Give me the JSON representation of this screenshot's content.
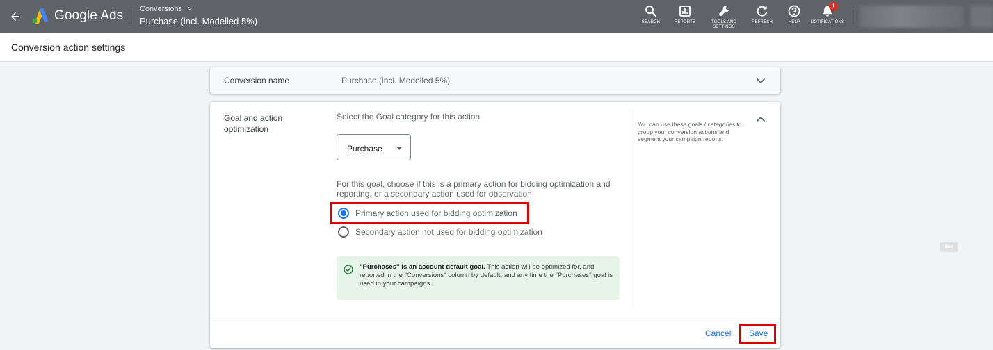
{
  "topbar": {
    "app_name": "Google Ads",
    "breadcrumb": "Conversions",
    "breadcrumb_arrow": ">",
    "page_name": "Purchase (incl. Modelled 5%)",
    "tools": [
      {
        "label": "SEARCH",
        "icon": "search-icon"
      },
      {
        "label": "REPORTS",
        "icon": "reports-icon"
      },
      {
        "label": "TOOLS AND SETTINGS",
        "icon": "wrench-icon"
      },
      {
        "label": "REFRESH",
        "icon": "refresh-icon"
      },
      {
        "label": "HELP",
        "icon": "help-icon"
      },
      {
        "label": "NOTIFICATIONS",
        "icon": "bell-icon",
        "badge": "!"
      }
    ]
  },
  "subheader": {
    "title": "Conversion action settings"
  },
  "conversion_name": {
    "label": "Conversion name",
    "value": "Purchase (incl. Modelled 5%)"
  },
  "goal": {
    "label": "Goal and action optimization",
    "select_heading": "Select the Goal category for this action",
    "category_value": "Purchase",
    "description": "For this goal, choose if this is a primary action for bidding optimization and reporting, or a secondary action used for observation.",
    "options": [
      {
        "label": "Primary action used for bidding optimization",
        "selected": true
      },
      {
        "label": "Secondary action not used for bidding optimization",
        "selected": false
      }
    ],
    "info_bold": "\"Purchases\" is an account default goal.",
    "info_text": " This action will be optimized for, and reported in the \"Conversions\" column by default, and any time the \"Purchases\" goal is used in your campaigns.",
    "help_text": "You can use these goals / categories to group your conversion actions and segment your campaign reports."
  },
  "actions": {
    "cancel": "Cancel",
    "save": "Save"
  },
  "blur_tag": "Blur",
  "colors": {
    "topbar": "#5f6368",
    "accent": "#1a73e8",
    "highlight": "#e00000",
    "info_bg": "#e6f4ea",
    "success": "#188038"
  }
}
